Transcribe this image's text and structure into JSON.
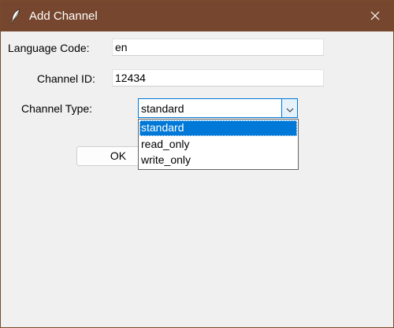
{
  "window": {
    "title": "Add Channel",
    "icon": "feather-icon",
    "close_icon": "close-icon"
  },
  "form": {
    "language_code_label": "Language Code:",
    "language_code_value": "en",
    "channel_id_label": "Channel ID:",
    "channel_id_value": "12434",
    "channel_type_label": "Channel Type:",
    "channel_type_value": "standard",
    "channel_type_options": [
      "standard",
      "read_only",
      "write_only"
    ],
    "ok_label": "OK"
  },
  "colors": {
    "titlebar": "#76472e",
    "accent": "#0078d7",
    "background": "#f0f0f0"
  }
}
